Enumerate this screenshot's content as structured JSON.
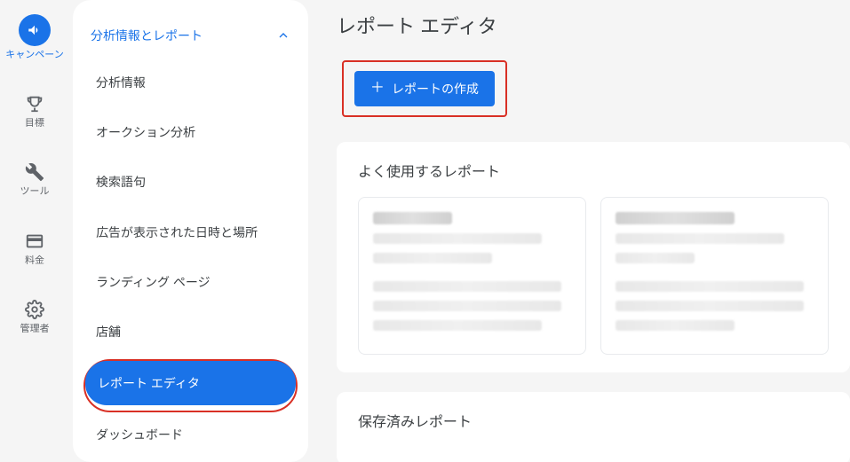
{
  "rail": {
    "campaign": "キャンペーン",
    "goals": "目標",
    "tools": "ツール",
    "billing": "料金",
    "admin": "管理者"
  },
  "panel": {
    "header": "分析情報とレポート",
    "items": [
      "分析情報",
      "オークション分析",
      "検索語句",
      "広告が表示された日時と場所",
      "ランディング ページ",
      "店舗",
      "レポート エディタ",
      "ダッシュボード"
    ]
  },
  "main": {
    "title": "レポート エディタ",
    "create_label": "レポートの作成",
    "frequently_used": "よく使用するレポート",
    "saved": "保存済みレポート"
  }
}
